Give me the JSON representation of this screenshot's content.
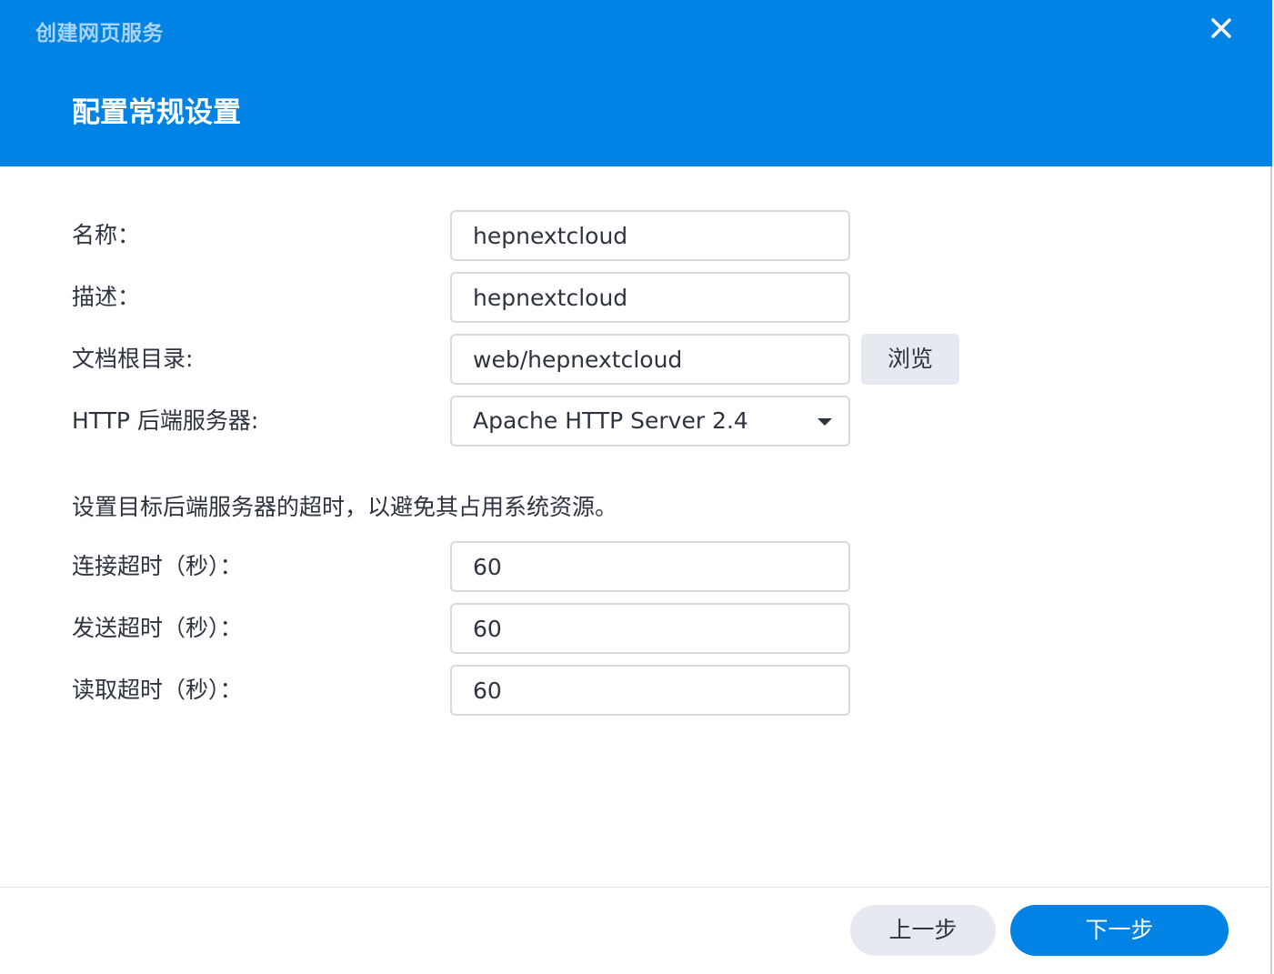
{
  "window": {
    "title": "创建网页服务",
    "heading": "配置常规设置"
  },
  "form": {
    "name": {
      "label": "名称：",
      "value": "hepnextcloud"
    },
    "description": {
      "label": "描述：",
      "value": "hepnextcloud"
    },
    "doc_root": {
      "label": "文档根目录:",
      "value": "web/hepnextcloud",
      "browse_label": "浏览"
    },
    "backend": {
      "label": "HTTP 后端服务器:",
      "selected": "Apache HTTP Server 2.4"
    }
  },
  "timeouts": {
    "description": "设置目标后端服务器的超时，以避免其占用系统资源。",
    "connect": {
      "label": "连接超时（秒）：",
      "value": "60"
    },
    "send": {
      "label": "发送超时（秒）：",
      "value": "60"
    },
    "read": {
      "label": "读取超时（秒）：",
      "value": "60"
    }
  },
  "footer": {
    "prev_label": "上一步",
    "next_label": "下一步"
  },
  "colors": {
    "header_bg": "#0083e4",
    "primary_button": "#0083e4",
    "secondary_button": "#e6eaf0",
    "text": "#2e3340"
  },
  "icons": {
    "close": "close-icon",
    "dropdown": "chevron-down-icon"
  }
}
